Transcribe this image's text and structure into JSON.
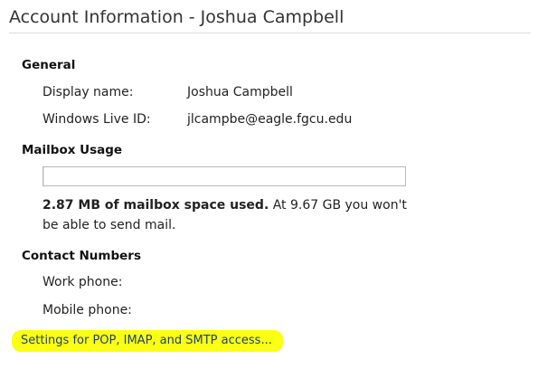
{
  "header": {
    "title": "Account Information - Joshua Campbell"
  },
  "general": {
    "heading": "General",
    "display_name_label": "Display name:",
    "display_name_value": "Joshua Campbell",
    "live_id_label": "Windows Live ID:",
    "live_id_value": "jlcampbe@eagle.fgcu.edu"
  },
  "mailbox": {
    "heading": "Mailbox Usage",
    "usage_fraction": 0.0003,
    "used_bold": "2.87 MB of mailbox space used.",
    "used_rest": " At 9.67 GB you won't be able to send mail."
  },
  "contact": {
    "heading": "Contact Numbers",
    "work_label": "Work phone:",
    "mobile_label": "Mobile phone:"
  },
  "links": {
    "settings": "Settings for POP, IMAP, and SMTP access..."
  },
  "colors": {
    "highlight": "#fbff12",
    "link": "#1f3f7a"
  }
}
